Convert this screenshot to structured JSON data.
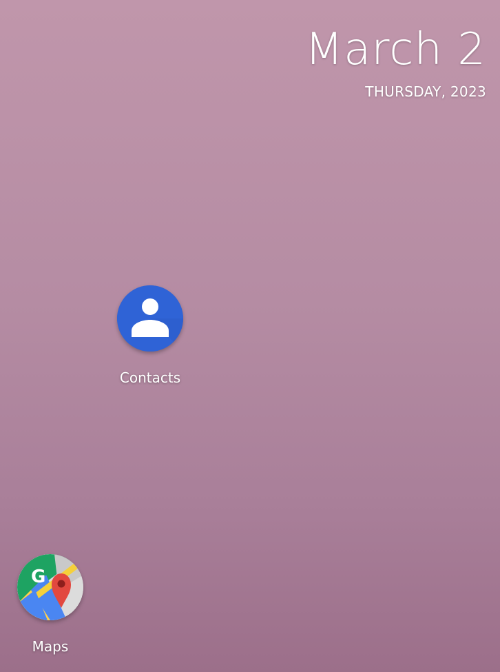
{
  "date_widget": {
    "date": "March 2",
    "weekday_year": "THURSDAY, 2023"
  },
  "apps": {
    "contacts": {
      "label": "Contacts",
      "icon": "contacts-icon",
      "color": "#2f63d6"
    },
    "maps": {
      "label": "Maps",
      "icon": "maps-icon"
    }
  },
  "colors": {
    "wallpaper_top": "#c096ab",
    "wallpaper_bottom": "#9c6f8a",
    "text": "#ffffff"
  }
}
